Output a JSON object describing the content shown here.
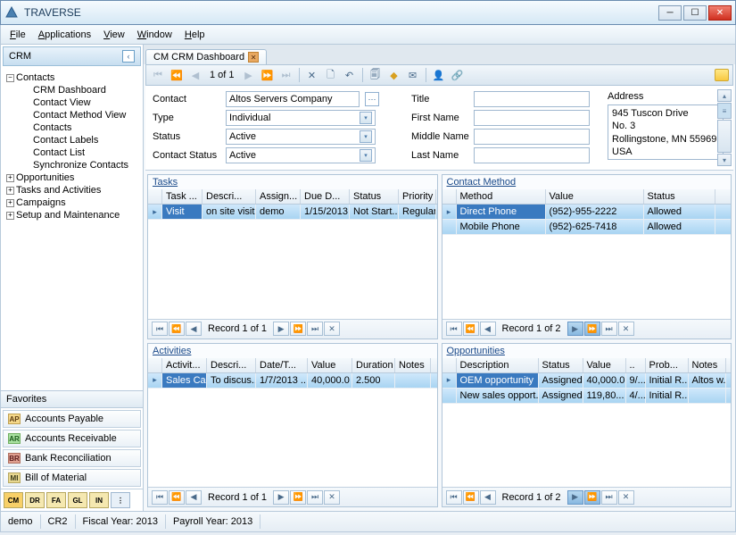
{
  "app_title": "TRAVERSE",
  "menubar": [
    "File",
    "Applications",
    "View",
    "Window",
    "Help"
  ],
  "sidebar": {
    "header": "CRM",
    "tree": [
      {
        "label": "Contacts",
        "children": [
          "CRM Dashboard",
          "Contact View",
          "Contact Method View",
          "Contacts",
          "Contact Labels",
          "Contact List",
          "Synchronize Contacts"
        ]
      },
      {
        "label": "Opportunities"
      },
      {
        "label": "Tasks and Activities"
      },
      {
        "label": "Campaigns"
      },
      {
        "label": "Setup and Maintenance"
      }
    ],
    "favorites_header": "Favorites",
    "favorites": [
      {
        "code": "AP",
        "label": "Accounts Payable"
      },
      {
        "code": "AR",
        "label": "Accounts Receivable"
      },
      {
        "code": "BR",
        "label": "Bank Reconciliation"
      },
      {
        "code": "MI",
        "label": "Bill of Material"
      }
    ],
    "bottom_btns": [
      "CM",
      "DR",
      "FA",
      "GL",
      "IN"
    ]
  },
  "tab_label": "CM CRM Dashboard",
  "toolbar_page": "1  of 1",
  "form": {
    "contact_label": "Contact",
    "contact_value": "Altos Servers Company",
    "type_label": "Type",
    "type_value": "Individual",
    "status_label": "Status",
    "status_value": "Active",
    "cstatus_label": "Contact Status",
    "cstatus_value": "Active",
    "title_label": "Title",
    "title_value": "",
    "fname_label": "First Name",
    "fname_value": "",
    "mname_label": "Middle Name",
    "mname_value": "",
    "lname_label": "Last Name",
    "lname_value": "",
    "address_label": "Address",
    "address_lines": [
      "945 Tuscon Drive",
      "No. 3",
      "Rollingstone, MN 55969",
      "USA"
    ]
  },
  "tasks": {
    "title": "Tasks",
    "columns": [
      "Task ...",
      "Descri...",
      "Assign...",
      "Due D...",
      "Status",
      "Priority"
    ],
    "rows": [
      [
        "Visit",
        "on site visit",
        "demo",
        "1/15/2013",
        "Not Start...",
        "Regular"
      ]
    ],
    "nav": "Record 1 of 1"
  },
  "contact_method": {
    "title": "Contact Method",
    "columns": [
      "Method",
      "Value",
      "Status"
    ],
    "rows": [
      [
        "Direct Phone",
        "(952)-955-2222",
        "Allowed"
      ],
      [
        "Mobile Phone",
        "(952)-625-7418",
        "Allowed"
      ]
    ],
    "nav": "Record 1 of 2"
  },
  "activities": {
    "title": "Activities",
    "columns": [
      "Activit...",
      "Descri...",
      "Date/T...",
      "Value",
      "Duration",
      "Notes"
    ],
    "rows": [
      [
        "Sales Call",
        "To discus...",
        "1/7/2013 ...",
        "40,000.0",
        "2.500",
        ""
      ]
    ],
    "nav": "Record 1 of 1"
  },
  "opportunities": {
    "title": "Opportunities",
    "columns": [
      "Description",
      "Status",
      "Value",
      "..",
      "Prob...",
      "Notes"
    ],
    "rows": [
      [
        "OEM opportunity",
        "Assigned",
        "40,000.0",
        "9/...",
        "Initial R...",
        "Altos w..."
      ],
      [
        "New sales opport...",
        "Assigned",
        "119,80...",
        "4/...",
        "Initial R...",
        ""
      ]
    ],
    "nav": "Record 1 of 2"
  },
  "statusbar": [
    "demo",
    "CR2",
    "Fiscal Year: 2013",
    "Payroll Year: 2013"
  ]
}
